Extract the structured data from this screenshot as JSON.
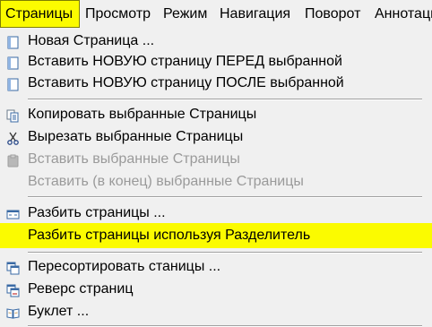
{
  "menubar": {
    "items": [
      {
        "label": "Страницы"
      },
      {
        "label": "Просмотр"
      },
      {
        "label": "Режим"
      },
      {
        "label": "Навигация"
      },
      {
        "label": "Поворот"
      },
      {
        "label": "Аннотаци"
      }
    ]
  },
  "menu": {
    "items": [
      {
        "label": "Новая Страница ...",
        "icon": "new-page-icon"
      },
      {
        "label": "Вставить НОВУЮ страницу ПЕРЕД выбранной",
        "icon": "insert-before-icon"
      },
      {
        "label": "Вставить НОВУЮ страницу ПОСЛЕ выбранной",
        "icon": "insert-after-icon"
      },
      {
        "label": "Копировать выбранные Страницы",
        "icon": "copy-icon"
      },
      {
        "label": "Вырезать выбранные Страницы",
        "icon": "scissors-icon"
      },
      {
        "label": "Вставить выбранные Страницы",
        "icon": "paste-icon",
        "disabled": true
      },
      {
        "label": "Вставить (в конец) выбранные Страницы",
        "disabled": true
      },
      {
        "label": "Разбить страницы ...",
        "icon": "split-icon"
      },
      {
        "label": "Разбить страницы используя Разделитель",
        "highlighted": true
      },
      {
        "label": "Пересортировать станицы ...",
        "icon": "reorder-icon"
      },
      {
        "label": "Реверс страниц",
        "icon": "reverse-icon"
      },
      {
        "label": "Буклет ...",
        "icon": "booklet-icon"
      }
    ]
  },
  "colors": {
    "highlight": "#fbfb00",
    "background": "#f0f0f0",
    "disabled_text": "#9a9a9a"
  }
}
